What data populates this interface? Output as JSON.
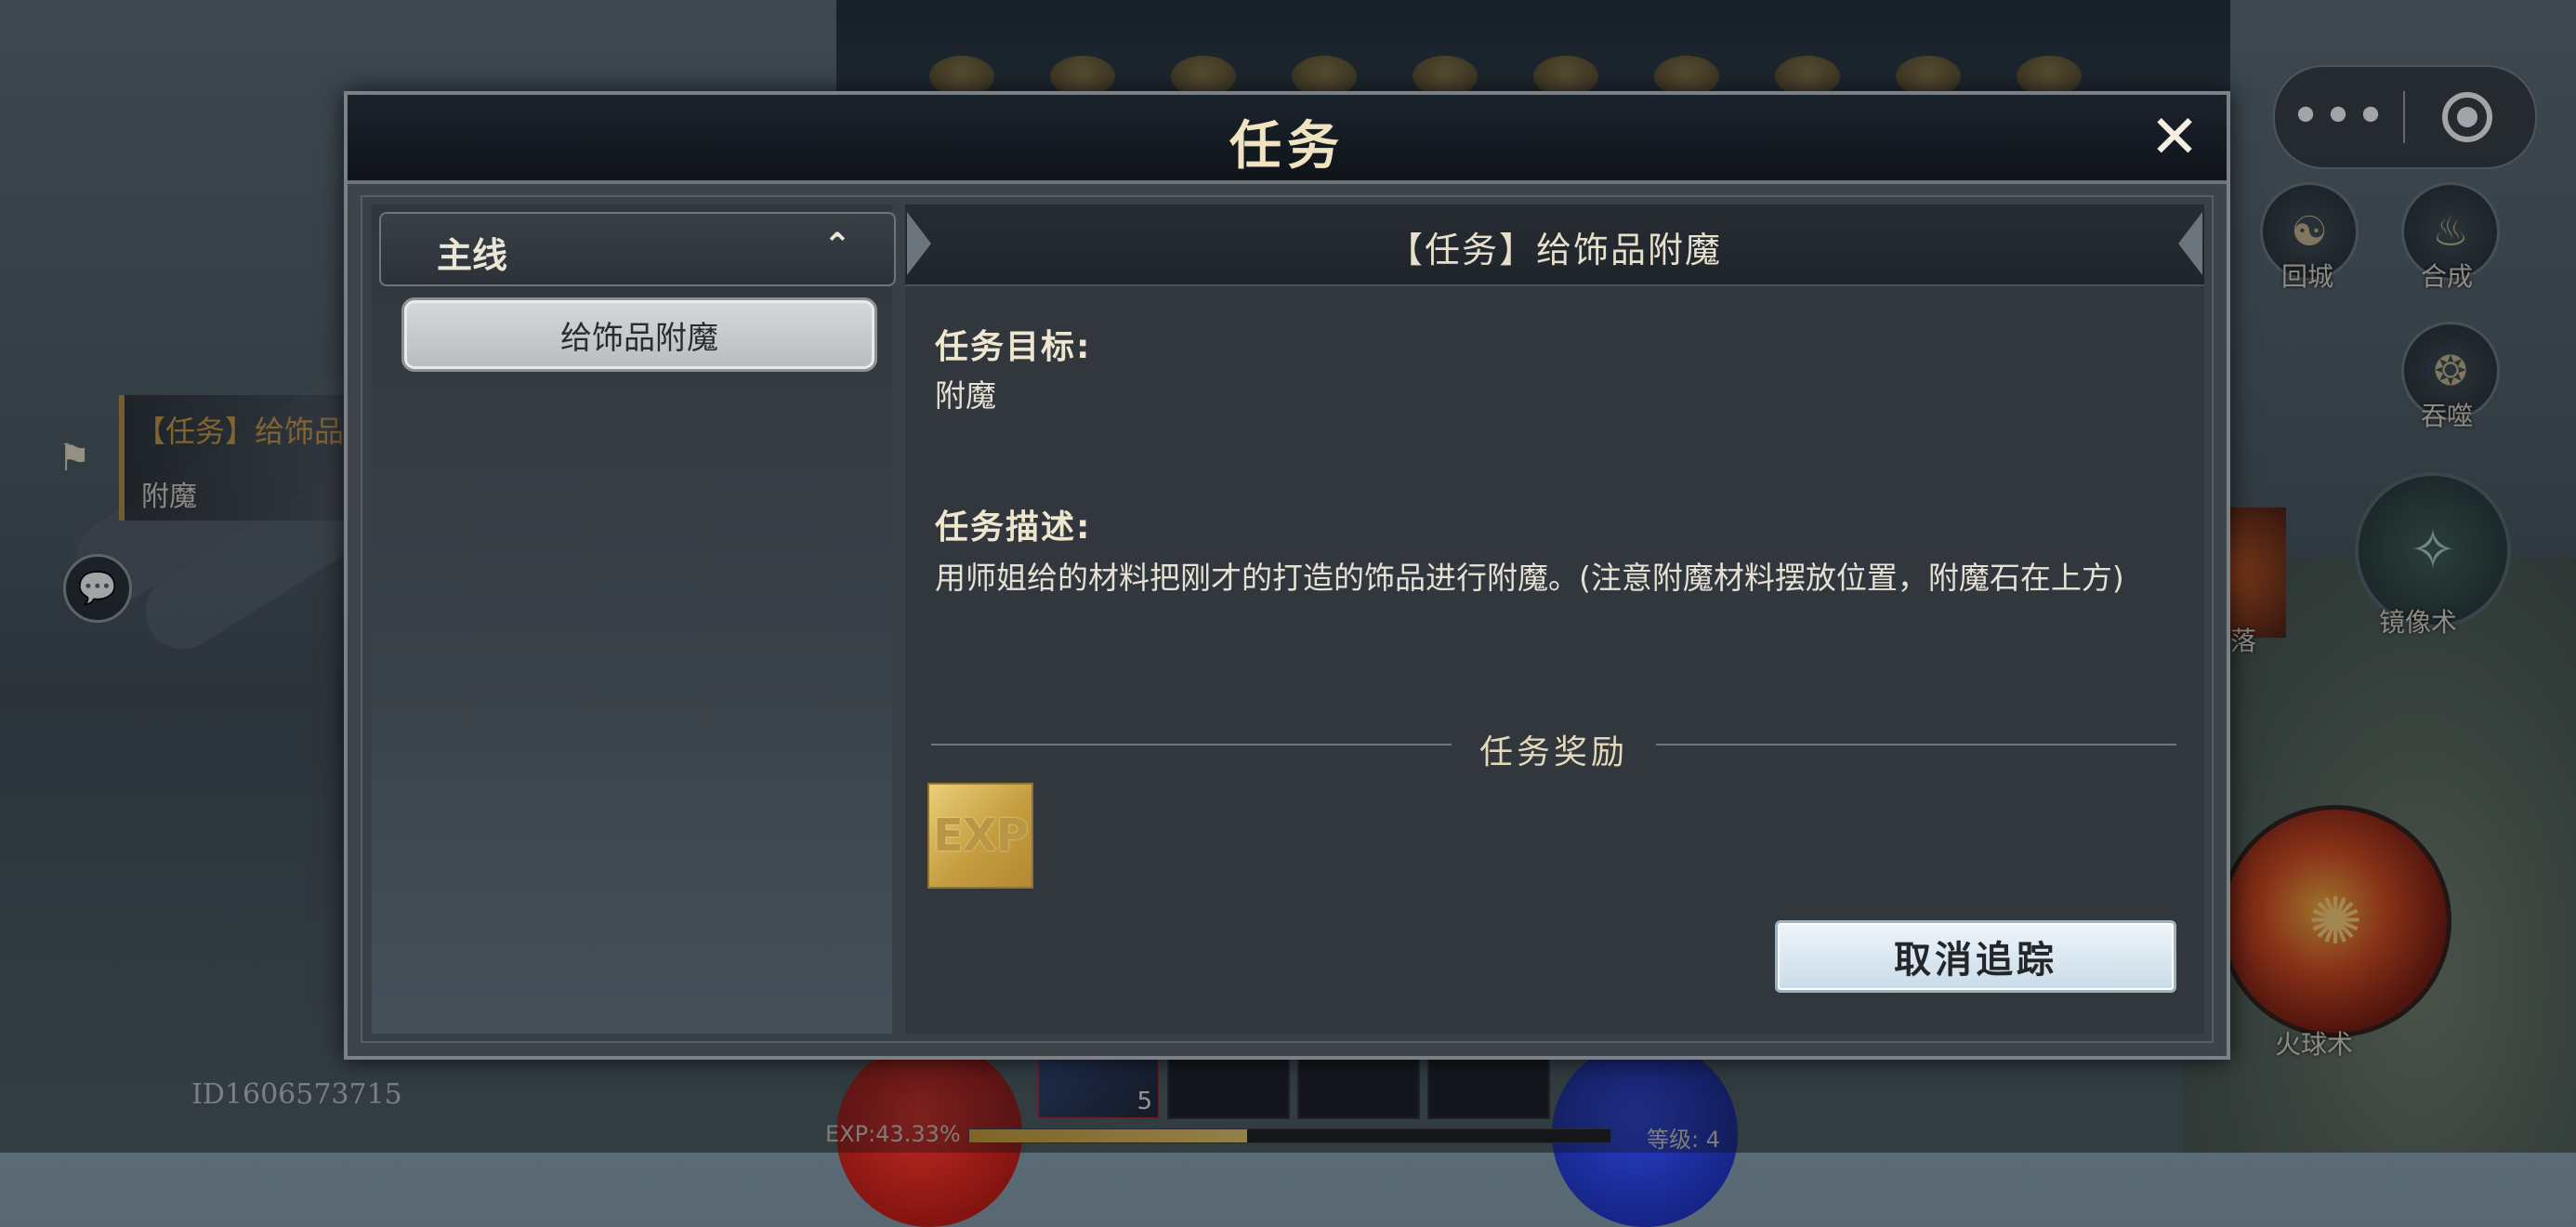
{
  "dialog": {
    "title": "任务",
    "close_glyph": "✕"
  },
  "categories": {
    "main_label": "主线",
    "chevron_glyph": "⌃",
    "quests": [
      {
        "label": "给饰品附魔",
        "selected": true
      }
    ]
  },
  "detail": {
    "title": "【任务】给饰品附魔",
    "goal_heading": "任务目标:",
    "goal_text": "附魔",
    "desc_heading": "任务描述:",
    "desc_text": "用师姐给的材料把刚才的打造的饰品进行附魔。(注意附魔材料摆放位置，附魔石在上方)",
    "reward_heading": "任务奖励",
    "rewards": [
      {
        "icon": "exp-icon",
        "label": "EXP"
      }
    ],
    "untrack_button": "取消追踪"
  },
  "background": {
    "tracker_title": "【任务】给饰品",
    "tracker_sub": "附魔",
    "player_id": "ID1606573715",
    "exp_label": "EXP:43.33%",
    "exp_progress": 0.4333,
    "level_label": "等级: 4",
    "hotbar_count": "5",
    "skills": {
      "return_city": "回城",
      "compose": "合成",
      "swallow": "吞噬",
      "partial": "落",
      "mirror": "镜像术",
      "fireball": "火球术"
    }
  },
  "miniprogram": {
    "more_glyph": "•••",
    "close_icon": "target-icon"
  },
  "colors": {
    "accent_gold": "#c79a46",
    "dialog_bg": "#3e444a",
    "button_bg": "#dbe8f1"
  }
}
